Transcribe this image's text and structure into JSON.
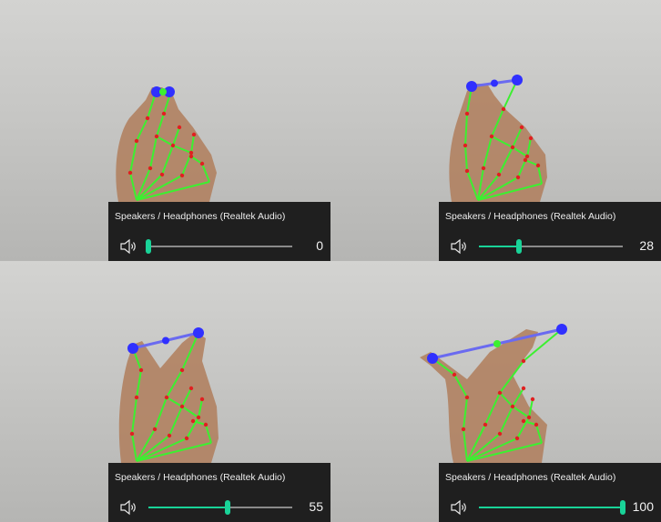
{
  "panels": [
    {
      "device_label": "Speakers / Headphones (Realtek Audio)",
      "volume": 0,
      "volume_text": "0",
      "speaker_icon": "speaker-volume-icon"
    },
    {
      "device_label": "Speakers / Headphones (Realtek Audio)",
      "volume": 28,
      "volume_text": "28",
      "speaker_icon": "speaker-volume-icon"
    },
    {
      "device_label": "Speakers / Headphones (Realtek Audio)",
      "volume": 55,
      "volume_text": "55",
      "speaker_icon": "speaker-volume-icon"
    },
    {
      "device_label": "Speakers / Headphones (Realtek Audio)",
      "volume": 100,
      "volume_text": "100",
      "speaker_icon": "speaker-volume-icon"
    }
  ],
  "colors": {
    "accent": "#19d398",
    "flyout_bg": "#1f1f1f",
    "landmark_line": "#3cf030",
    "landmark_point": "#e02020",
    "pinch_line": "#6a6af0",
    "pinch_point": "#3030ff",
    "skin": "#b07f5e"
  }
}
